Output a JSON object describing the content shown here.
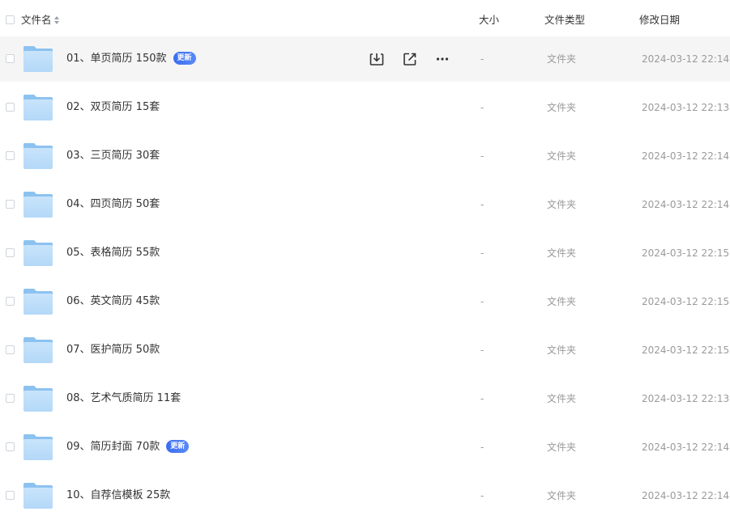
{
  "header": {
    "name_label": "文件名",
    "size_label": "大小",
    "type_label": "文件类型",
    "date_label": "修改日期"
  },
  "colors": {
    "folder_light": "#c8e4fb",
    "folder_dark": "#8cc2f0",
    "badge": "#3a6cf0",
    "hover_row": "#f5f5f5",
    "muted_text": "#9a9a9a"
  },
  "hover_actions": [
    {
      "icon": "download-icon"
    },
    {
      "icon": "share-icon"
    },
    {
      "icon": "more-icon"
    }
  ],
  "rows": [
    {
      "name": "01、单页简历 150款",
      "badge": "更新",
      "size": "-",
      "type": "文件夹",
      "date": "2024-03-12 22:14"
    },
    {
      "name": "02、双页简历 15套",
      "badge": "",
      "size": "-",
      "type": "文件夹",
      "date": "2024-03-12 22:13"
    },
    {
      "name": "03、三页简历 30套",
      "badge": "",
      "size": "-",
      "type": "文件夹",
      "date": "2024-03-12 22:14"
    },
    {
      "name": "04、四页简历 50套",
      "badge": "",
      "size": "-",
      "type": "文件夹",
      "date": "2024-03-12 22:14"
    },
    {
      "name": "05、表格简历 55款",
      "badge": "",
      "size": "-",
      "type": "文件夹",
      "date": "2024-03-12 22:15"
    },
    {
      "name": "06、英文简历 45款",
      "badge": "",
      "size": "-",
      "type": "文件夹",
      "date": "2024-03-12 22:15"
    },
    {
      "name": "07、医护简历 50款",
      "badge": "",
      "size": "-",
      "type": "文件夹",
      "date": "2024-03-12 22:15"
    },
    {
      "name": "08、艺术气质简历 11套",
      "badge": "",
      "size": "-",
      "type": "文件夹",
      "date": "2024-03-12 22:13"
    },
    {
      "name": "09、简历封面 70款",
      "badge": "更新",
      "size": "-",
      "type": "文件夹",
      "date": "2024-03-12 22:14"
    },
    {
      "name": "10、自荐信模板 25款",
      "badge": "",
      "size": "-",
      "type": "文件夹",
      "date": "2024-03-12 22:14"
    }
  ]
}
